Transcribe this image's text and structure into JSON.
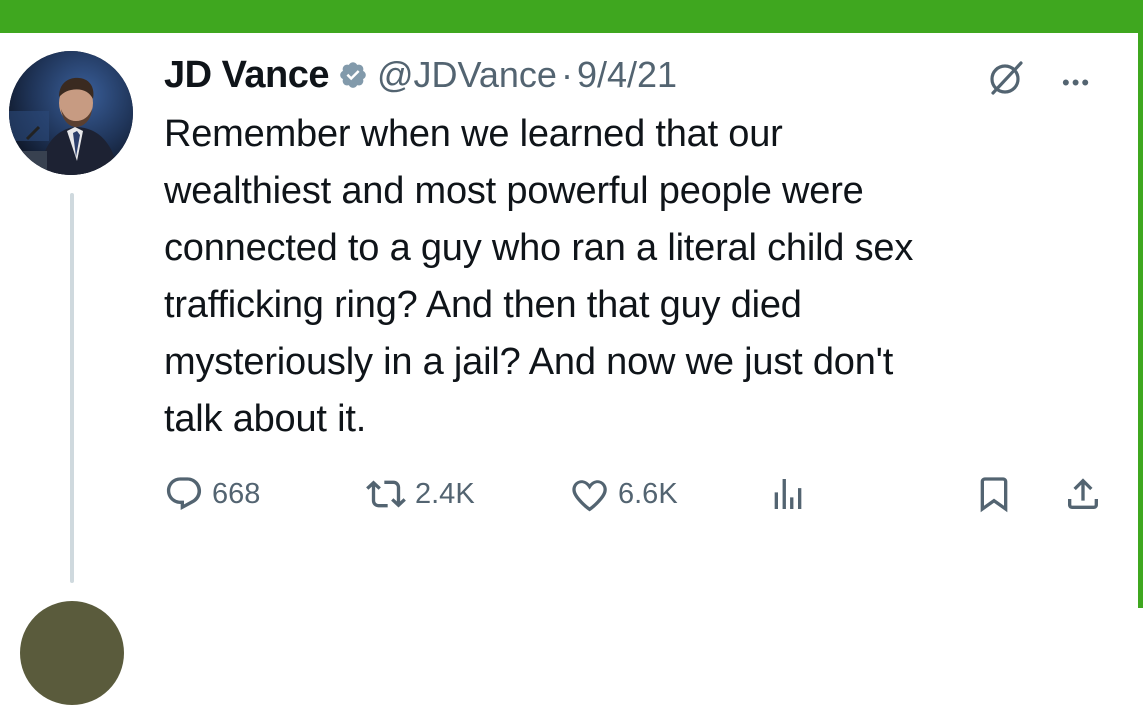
{
  "tweet": {
    "author": {
      "display_name": "JD Vance",
      "handle": "@JDVance",
      "verified": true
    },
    "separator": "·",
    "date": "9/4/21",
    "text": "Remember when we learned that our wealthiest and most powerful people were connected to a guy who ran a literal child sex trafficking ring? And then that guy died mysteriously in a jail? And now we just don't talk about it.",
    "text_lines": [
      "Remember when we learned that our",
      "wealthiest and most powerful people were",
      "connected to a guy who ran a literal child sex",
      "trafficking ring? And then that guy died",
      "mysteriously in a jail? And now we just don't",
      "talk about it."
    ],
    "actions": {
      "replies": "668",
      "reposts": "2.4K",
      "likes": "6.6K"
    }
  },
  "icons": {
    "verified": "verified-badge-icon",
    "grok": "grok-icon",
    "more": "more-options-icon",
    "reply": "reply-icon",
    "repost": "repost-icon",
    "like": "heart-icon",
    "views": "analytics-icon",
    "bookmark": "bookmark-icon",
    "share": "share-icon"
  },
  "colors": {
    "frame_green": "#3fa71f",
    "text_primary": "#0f1419",
    "text_secondary": "#536471",
    "verified_badge": "#829aab",
    "thread_line": "#cfd9de"
  }
}
